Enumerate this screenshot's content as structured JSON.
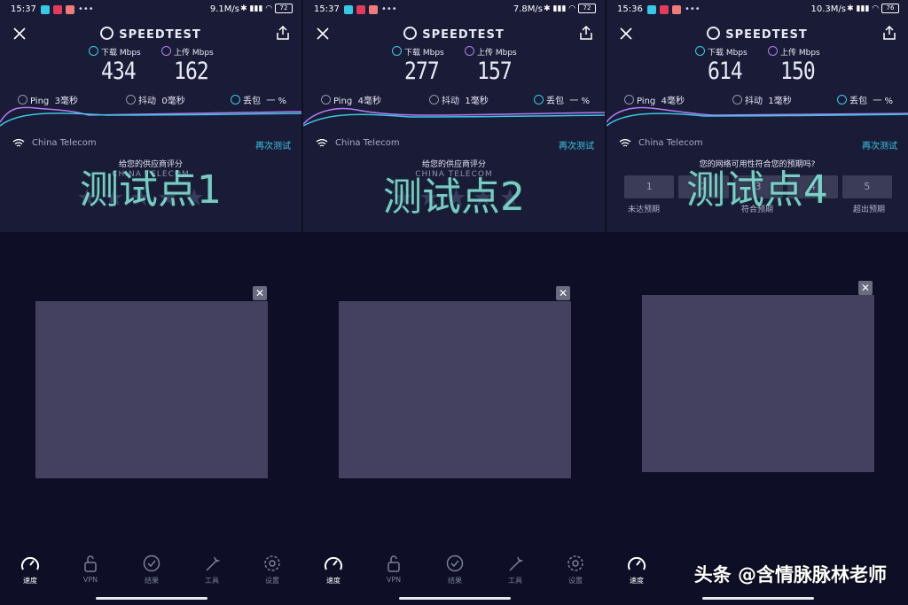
{
  "app": {
    "logo": "SPEEDTEST"
  },
  "labels": {
    "download": "下载 Mbps",
    "upload": "上传 Mbps",
    "ping": "Ping",
    "jitter": "抖动",
    "loss": "丢包",
    "loss_value": "一 %",
    "isp": "China Telecom",
    "retest": "再次测试"
  },
  "nav": [
    "速度",
    "VPN",
    "结果",
    "工具",
    "设置"
  ],
  "panels": [
    {
      "status": {
        "time": "15:37",
        "speed": "9.1M/s",
        "battery": "72"
      },
      "download": "434",
      "upload": "162",
      "ping": "3毫秒",
      "jitter": "0毫秒",
      "prompt": "给您的供应商评分",
      "prompt_sub": "CHINA TELECOM",
      "watermark": "测试点1"
    },
    {
      "status": {
        "time": "15:37",
        "speed": "7.8M/s",
        "battery": "72"
      },
      "download": "277",
      "upload": "157",
      "ping": "4毫秒",
      "jitter": "1毫秒",
      "prompt": "给您的供应商评分",
      "prompt_sub": "CHINA TELECOM",
      "watermark": "测试点2"
    },
    {
      "status": {
        "time": "15:36",
        "speed": "10.3M/s",
        "battery": "76"
      },
      "download": "614",
      "upload": "150",
      "ping": "4毫秒",
      "jitter": "1毫秒",
      "prompt": "您的网络可用性符合您的预期吗?",
      "rating_options": [
        "1",
        "2",
        "3",
        "4",
        "5"
      ],
      "rating_labels": [
        "未达预期",
        "符合预期",
        "超出预期"
      ],
      "watermark": "测试点4"
    }
  ],
  "brand_watermark": "头条 @含情脉脉林老师",
  "colors": {
    "download": "#39c7e6",
    "upload": "#b27bf5",
    "accent": "#39c7e6"
  }
}
